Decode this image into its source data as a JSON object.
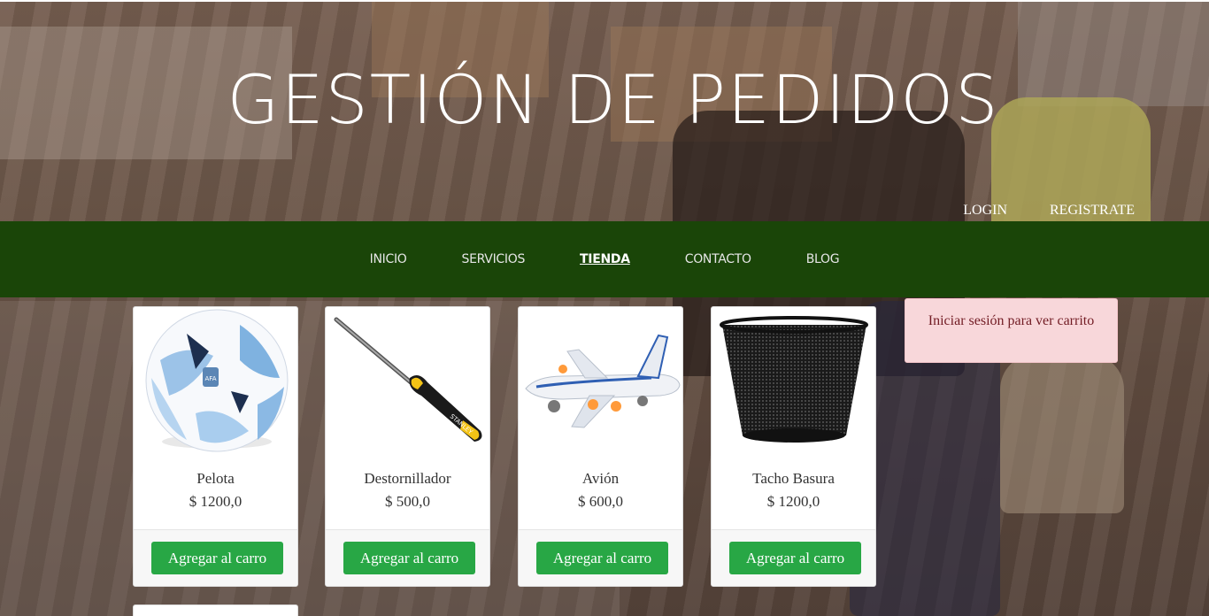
{
  "hero": {
    "title": "GESTIÓN DE PEDIDOS"
  },
  "auth": {
    "login": "LOGIN",
    "register": "REGISTRATE"
  },
  "nav": {
    "items": [
      {
        "label": "INICIO"
      },
      {
        "label": "SERVICIOS"
      },
      {
        "label": "TIENDA"
      },
      {
        "label": "CONTACTO"
      },
      {
        "label": "BLOG"
      }
    ],
    "active": "TIENDA"
  },
  "products": [
    {
      "name": "Pelota",
      "price": "$ 1200,0",
      "button": "Agregar al carro",
      "icon": "soccer-ball-icon"
    },
    {
      "name": "Destornillador",
      "price": "$ 500,0",
      "button": "Agregar al carro",
      "icon": "screwdriver-icon"
    },
    {
      "name": "Avión",
      "price": "$ 600,0",
      "button": "Agregar al carro",
      "icon": "airplane-icon"
    },
    {
      "name": "Tacho Basura",
      "price": "$ 1200,0",
      "button": "Agregar al carro",
      "icon": "trash-bin-icon"
    }
  ],
  "cart": {
    "message": "Iniciar sesión para ver carrito"
  },
  "colors": {
    "nav_bg": "#1a4508",
    "button": "#28a745",
    "alert_bg": "#f8d7da",
    "alert_text": "#721c24"
  }
}
